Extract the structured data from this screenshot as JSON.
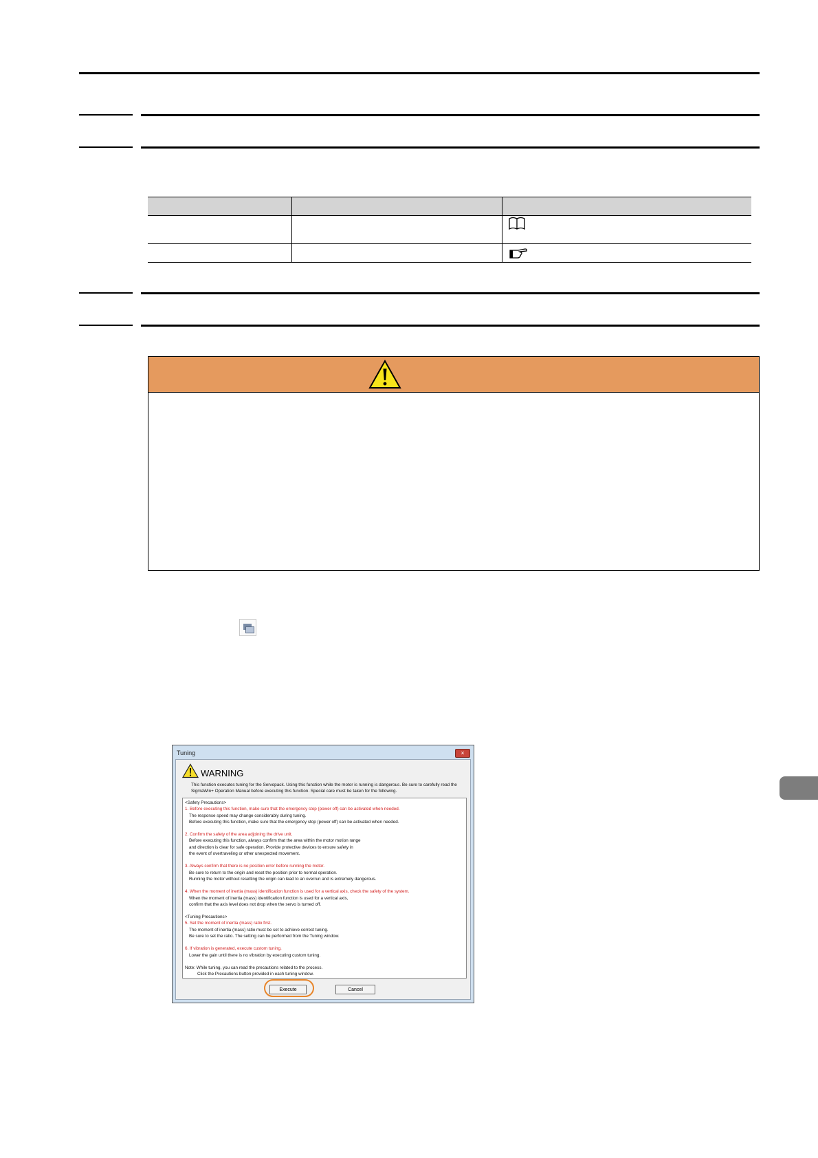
{
  "caution_box": {
    "header_color": "#e59a5e"
  },
  "dialog": {
    "title": "Tuning",
    "close_label": "×",
    "warning_title": "WARNING",
    "description": "This function executes tuning for the Servopack. Using this function while the motor is running is dangerous. Be sure to carefully read the SigmaWin+ Operation Manual before executing this function. Special care must be taken for the following.",
    "safety_header": "<Safety Precautions>",
    "safety_items": [
      {
        "title": "1. Before executing this function, make sure that the emergency stop (power off) can be activated when needed.",
        "lines": [
          "The response speed may change considerably during tuning.",
          "Before executing this function, make sure that the emergency stop (power off) can be activated when needed."
        ]
      },
      {
        "title": "2. Confirm the safety of the area adjoining the drive unit.",
        "lines": [
          "Before executing this function, always confirm that the area within the motor motion range",
          "and direction is clear for safe operation. Provide protective devices to ensure safety in",
          "the event of overtraveling or other unexpected movement."
        ]
      },
      {
        "title": "3. Always confirm that there is no position error before running the motor.",
        "lines": [
          "Be sure to return to the origin and reset the position prior to normal operation.",
          "Running the motor without resetting the origin can lead to an overrun and is extremely dangerous."
        ]
      },
      {
        "title": "4. When the moment of inertia (mass) identification function is used for a vertical axis, check the safety of the system.",
        "lines": [
          "When the moment of inertia (mass) identification function is used for a vertical axis,",
          "confirm that the axis level does not drop when the servo is turned off."
        ]
      }
    ],
    "tuning_header": "<Tuning Precautions>",
    "tuning_items": [
      {
        "title": "5. Set the moment of inertia (mass) ratio first.",
        "lines": [
          "The moment of inertia (mass) ratio must be set to achieve correct tuning.",
          "Be sure to set the ratio. The setting can be performed from the Tuning window."
        ]
      },
      {
        "title": "6. If vibration is generated, execute custom tuning.",
        "lines": [
          "Lower the gain until there is no vibration by executing custom tuning."
        ]
      }
    ],
    "note_line1": "Note: While tuning, you can read the precautions related to the process.",
    "note_line2": "Click the Precautions button provided in each tuning window.",
    "execute_label": "Execute",
    "cancel_label": "Cancel"
  }
}
